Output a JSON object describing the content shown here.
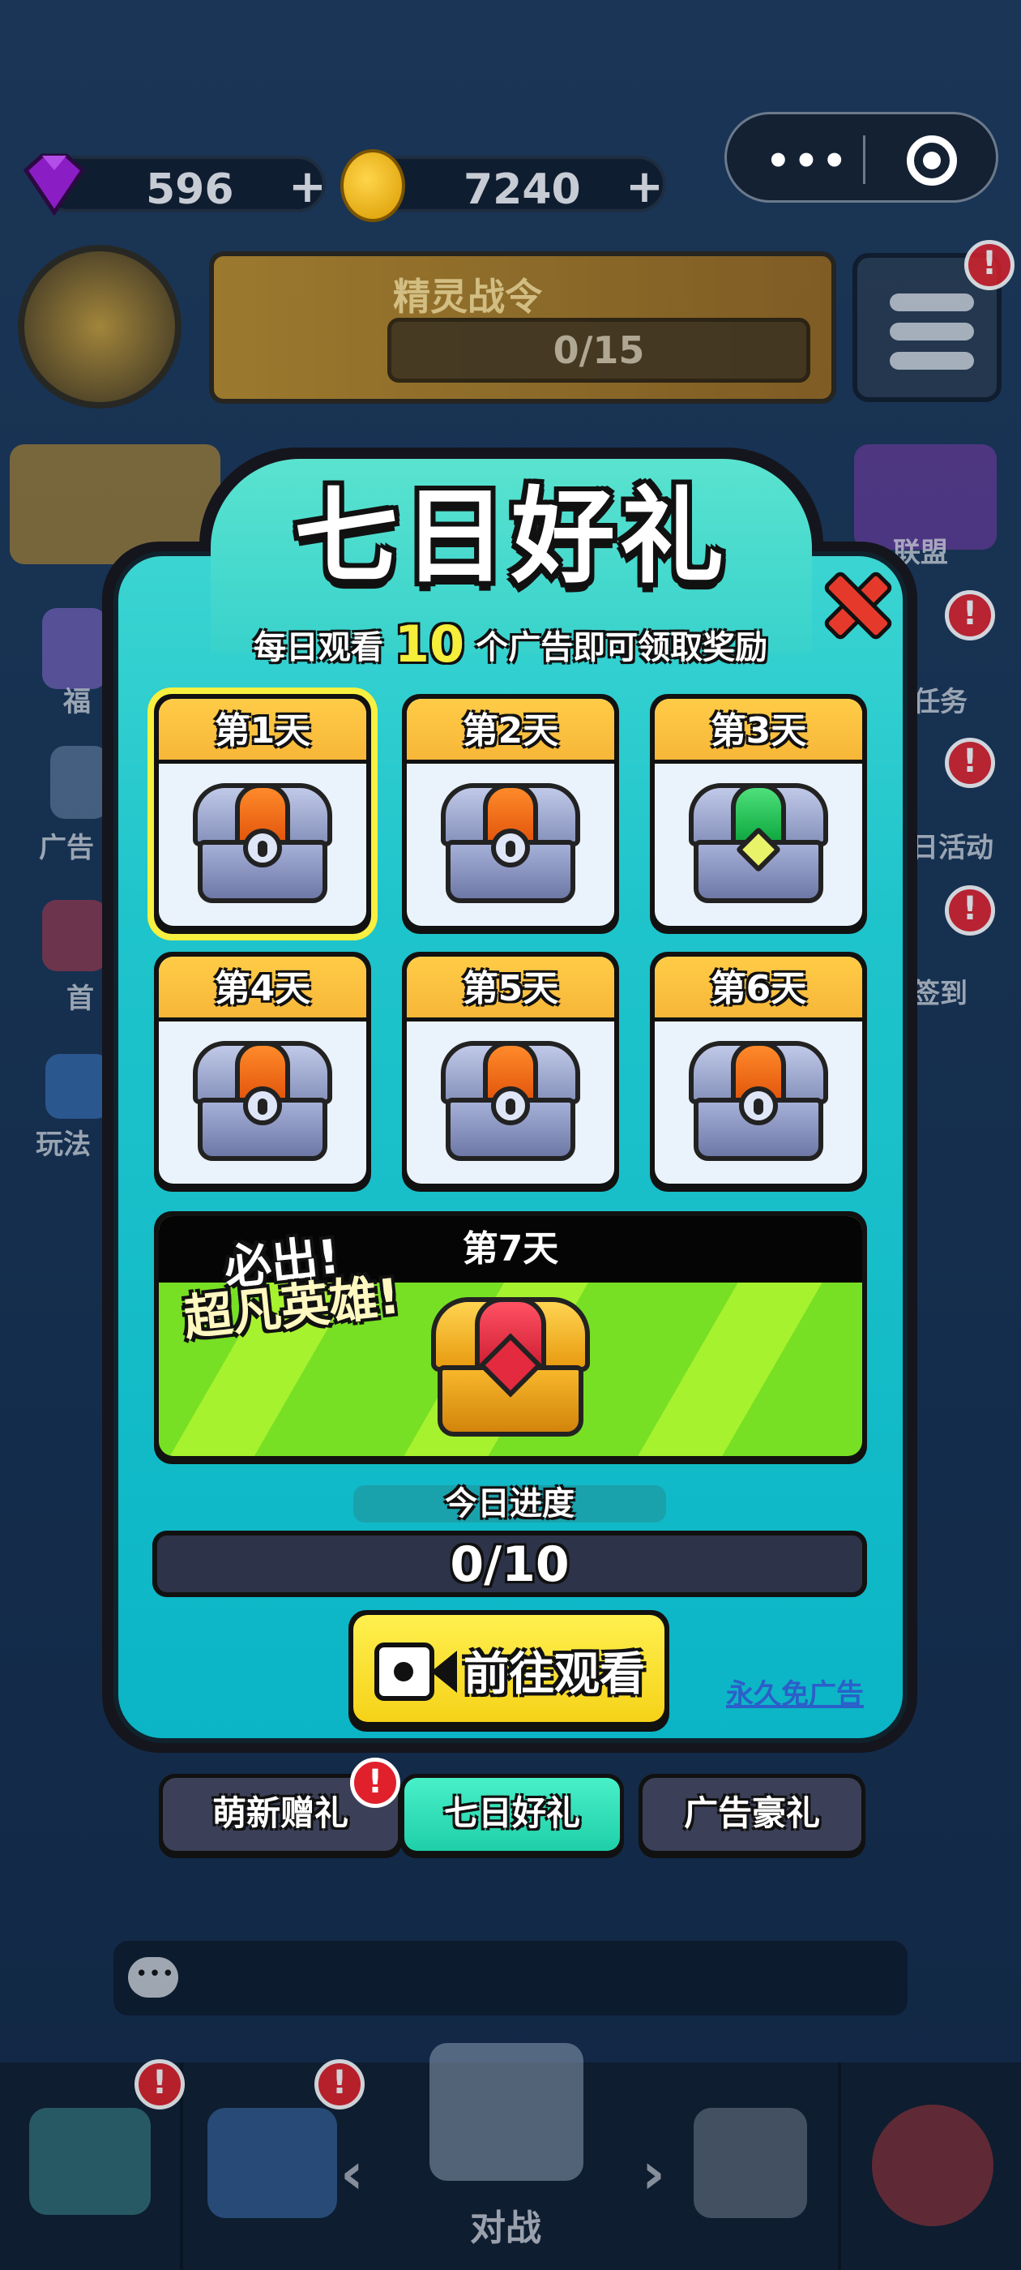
{
  "hud": {
    "gems": "596",
    "coins": "7240",
    "plus": "+",
    "pass_title": "精灵战令",
    "pass_progress": "0/15",
    "capsule_dots": "•••"
  },
  "side_menu": {
    "left": [
      "福",
      "广告",
      "首",
      "玩法"
    ],
    "right": [
      "联盟",
      "任务",
      "日活动",
      "签到"
    ],
    "badge": "!"
  },
  "modal": {
    "title": "七日好礼",
    "subtitle_prefix": "每日观看",
    "subtitle_count": "10",
    "subtitle_suffix": "个广告即可领取奖励",
    "days": [
      {
        "label": "第1天",
        "chest": "silver",
        "selected": true
      },
      {
        "label": "第2天",
        "chest": "silver"
      },
      {
        "label": "第3天",
        "chest": "green"
      },
      {
        "label": "第4天",
        "chest": "silver"
      },
      {
        "label": "第5天",
        "chest": "silver"
      },
      {
        "label": "第6天",
        "chest": "silver"
      }
    ],
    "day7": {
      "label": "第7天",
      "promo_line1": "必出!",
      "promo_line2": "超凡英雄!",
      "chest": "gold"
    },
    "progress": {
      "label": "今日进度",
      "text": "0/10",
      "value": 0,
      "max": 10
    },
    "watch_button": "前往观看",
    "no_ads_link": "永久免广告"
  },
  "tabs": [
    {
      "label": "萌新赠礼",
      "badge": "!"
    },
    {
      "label": "七日好礼",
      "active": true
    },
    {
      "label": "广告豪礼"
    }
  ],
  "nav": {
    "center_label": "对战",
    "left_arrow": "‹",
    "right_arrow": "›",
    "badge": "!"
  },
  "colors": {
    "modal_bg": "#1fc4cb",
    "card_header": "#ffcc47",
    "button_yellow": "#f5d218",
    "tab_active": "#1fcfa8",
    "tab_inactive": "#3b4058",
    "badge_red": "#e0212b"
  }
}
